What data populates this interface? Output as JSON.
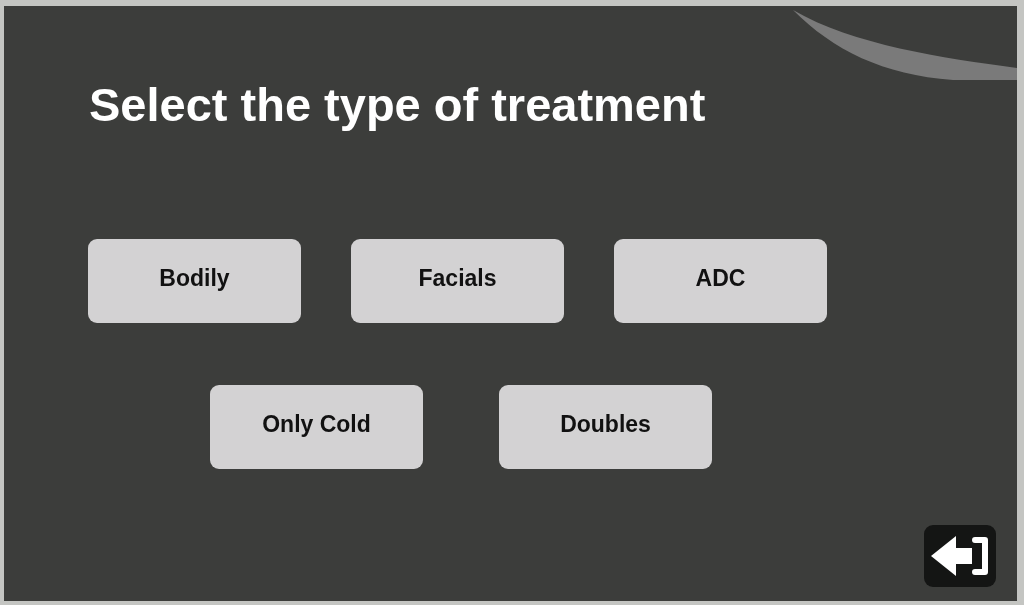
{
  "title": "Select the type of treatment",
  "treatment_rows": [
    {
      "options": [
        "Bodily",
        "Facials",
        "ADC"
      ]
    },
    {
      "options": [
        "Only Cold",
        "Doubles"
      ]
    }
  ]
}
